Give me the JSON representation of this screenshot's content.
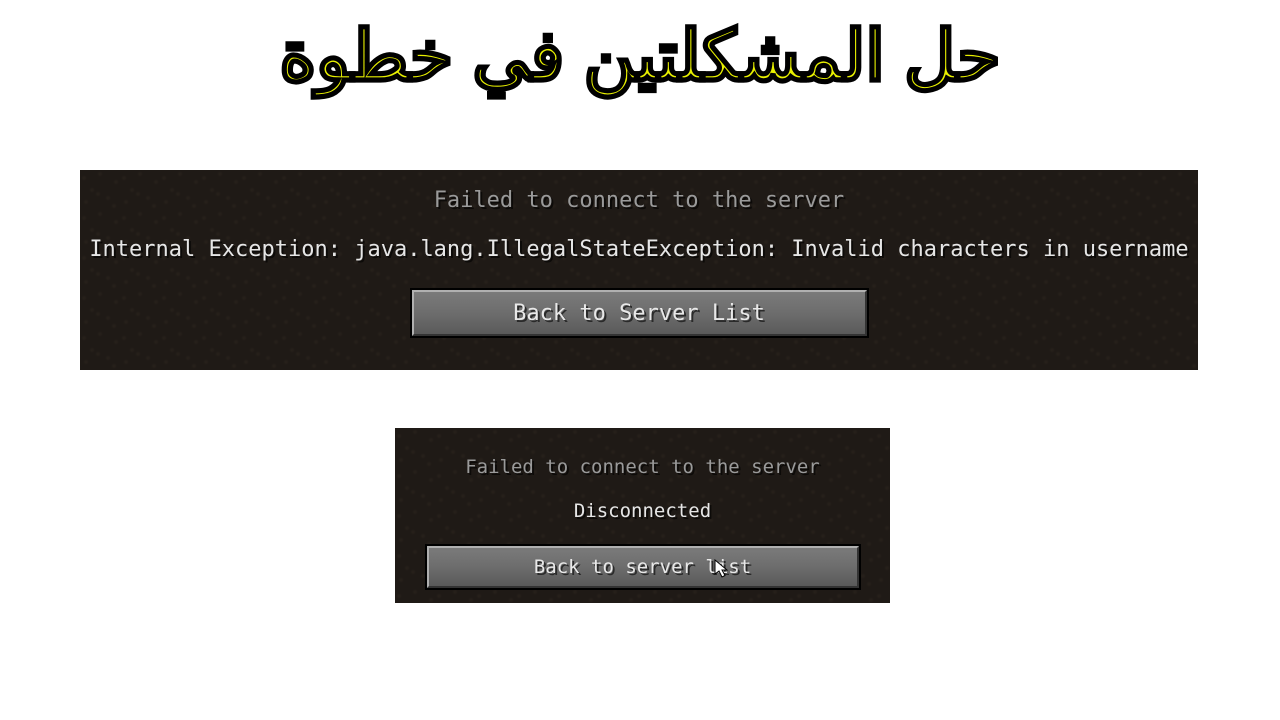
{
  "title_arabic": "حل المشكلتين في خطوة",
  "panel1": {
    "header": "Failed to connect to the server",
    "body": "Internal Exception: java.lang.IllegalStateException: Invalid characters in username",
    "button": "Back to Server List"
  },
  "panel2": {
    "header": "Failed to connect to the server",
    "body": "Disconnected",
    "button": "Back to server list"
  },
  "colors": {
    "title_fill": "#e8f000",
    "title_stroke": "#000000",
    "panel_bg": "#1f1a16",
    "header_text": "#9a9a9a",
    "body_text": "#e6e6e6",
    "button_bg": "#6d6d6d",
    "button_text": "#e8e8e8"
  }
}
